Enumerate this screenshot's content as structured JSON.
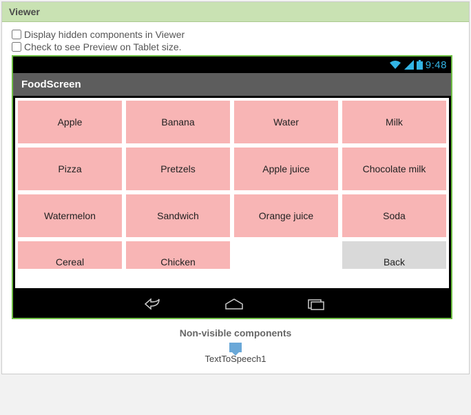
{
  "panel": {
    "title": "Viewer"
  },
  "options": {
    "display_hidden_label": "Display hidden components in Viewer",
    "tablet_preview_label": "Check to see Preview on Tablet size."
  },
  "status": {
    "time": "9:48"
  },
  "app": {
    "title": "FoodScreen"
  },
  "grid": {
    "rows": [
      [
        "Apple",
        "Banana",
        "Water",
        "Milk"
      ],
      [
        "Pizza",
        "Pretzels",
        "Apple juice",
        "Chocolate milk"
      ],
      [
        "Watermelon",
        "Sandwich",
        "Orange juice",
        "Soda"
      ]
    ],
    "last_row": [
      "Cereal",
      "Chicken"
    ],
    "back_label": "Back"
  },
  "non_visible": {
    "heading": "Non-visible components",
    "item1": "TextToSpeech1"
  }
}
